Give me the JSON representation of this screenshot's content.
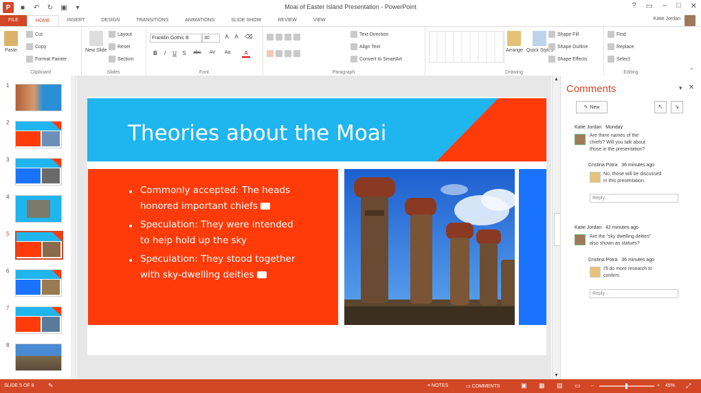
{
  "window": {
    "title": "Moai of Easter Island Presentation - PowerPoint",
    "app_icon": "P",
    "controls": [
      "?",
      "▭",
      "–",
      "□",
      "✕"
    ]
  },
  "tabs": [
    {
      "label": "FILE"
    },
    {
      "label": "HOME"
    },
    {
      "label": "INSERT"
    },
    {
      "label": "DESIGN"
    },
    {
      "label": "TRANSITIONS"
    },
    {
      "label": "ANIMATIONS"
    },
    {
      "label": "SLIDE SHOW"
    },
    {
      "label": "REVIEW"
    },
    {
      "label": "VIEW"
    }
  ],
  "user": {
    "name": "Katie Jordan"
  },
  "ribbon": {
    "clipboard": {
      "label": "Clipboard",
      "paste": "Paste",
      "cut": "Cut",
      "copy": "Copy",
      "format_painter": "Format Painter"
    },
    "slides": {
      "label": "Slides",
      "new_slide": "New Slide",
      "layout": "Layout",
      "reset": "Reset",
      "section": "Section"
    },
    "font": {
      "label": "Font",
      "name": "Franklin Gothic B",
      "size": "30",
      "bold": "B",
      "italic": "I",
      "underline": "U",
      "shadow": "S",
      "strike": "abc",
      "spacing": "AV",
      "case": "Aa",
      "color": "A"
    },
    "paragraph": {
      "label": "Paragraph",
      "text_direction": "Text Direction",
      "align_text": "Align Text",
      "smartart": "Convert to SmartArt"
    },
    "drawing": {
      "label": "Drawing",
      "arrange": "Arrange",
      "quick_styles": "Quick Styles",
      "shape_fill": "Shape Fill",
      "shape_outline": "Shape Outline",
      "shape_effects": "Shape Effects"
    },
    "editing": {
      "label": "Editing",
      "find": "Find",
      "replace": "Replace",
      "select": "Select"
    }
  },
  "thumbnails": [
    {
      "num": "1"
    },
    {
      "num": "2"
    },
    {
      "num": "3"
    },
    {
      "num": "4"
    },
    {
      "num": "5"
    },
    {
      "num": "6"
    },
    {
      "num": "7"
    },
    {
      "num": "8"
    }
  ],
  "slide": {
    "title": "Theories about the Moai",
    "bullets": [
      {
        "line1": "Commonly accepted: The heads",
        "line2": "honored important chiefs"
      },
      {
        "line1": "Speculation: They were intended",
        "line2": "to help hold up the sky"
      },
      {
        "line1": "Speculation: They stood together",
        "line2": "with sky-dwelling deities"
      }
    ]
  },
  "comments": {
    "pane_title": "Comments",
    "new_label": "New",
    "threads": [
      {
        "author": "Katie Jordan",
        "time": "Monday",
        "lines": [
          "Are there names of the",
          "chiefs? Will you talk about",
          "those in the presentation?"
        ],
        "reply": {
          "author": "Cristina Potra",
          "time": "36 minutes ago",
          "lines": [
            "No, those will be discussed",
            "in this presentation."
          ]
        },
        "reply_placeholder": "Reply..."
      },
      {
        "author": "Katie Jordan",
        "time": "42 minutes ago",
        "lines": [
          "Are the \"sky dwelling deities\"",
          "also shown as statues?"
        ],
        "reply": {
          "author": "Cristina Potra",
          "time": "36 minutes ago",
          "lines": [
            "I'll do more research to",
            "confirm."
          ]
        },
        "reply_placeholder": "Reply..."
      }
    ]
  },
  "status": {
    "slide": "SLIDE 5 OF 8",
    "notes": "NOTES",
    "comments": "COMMENTS",
    "zoom": "45%"
  },
  "colors": {
    "accent": "#d24726",
    "slide_blue": "#1fb5ef",
    "slide_orange": "#ff3b0a"
  }
}
